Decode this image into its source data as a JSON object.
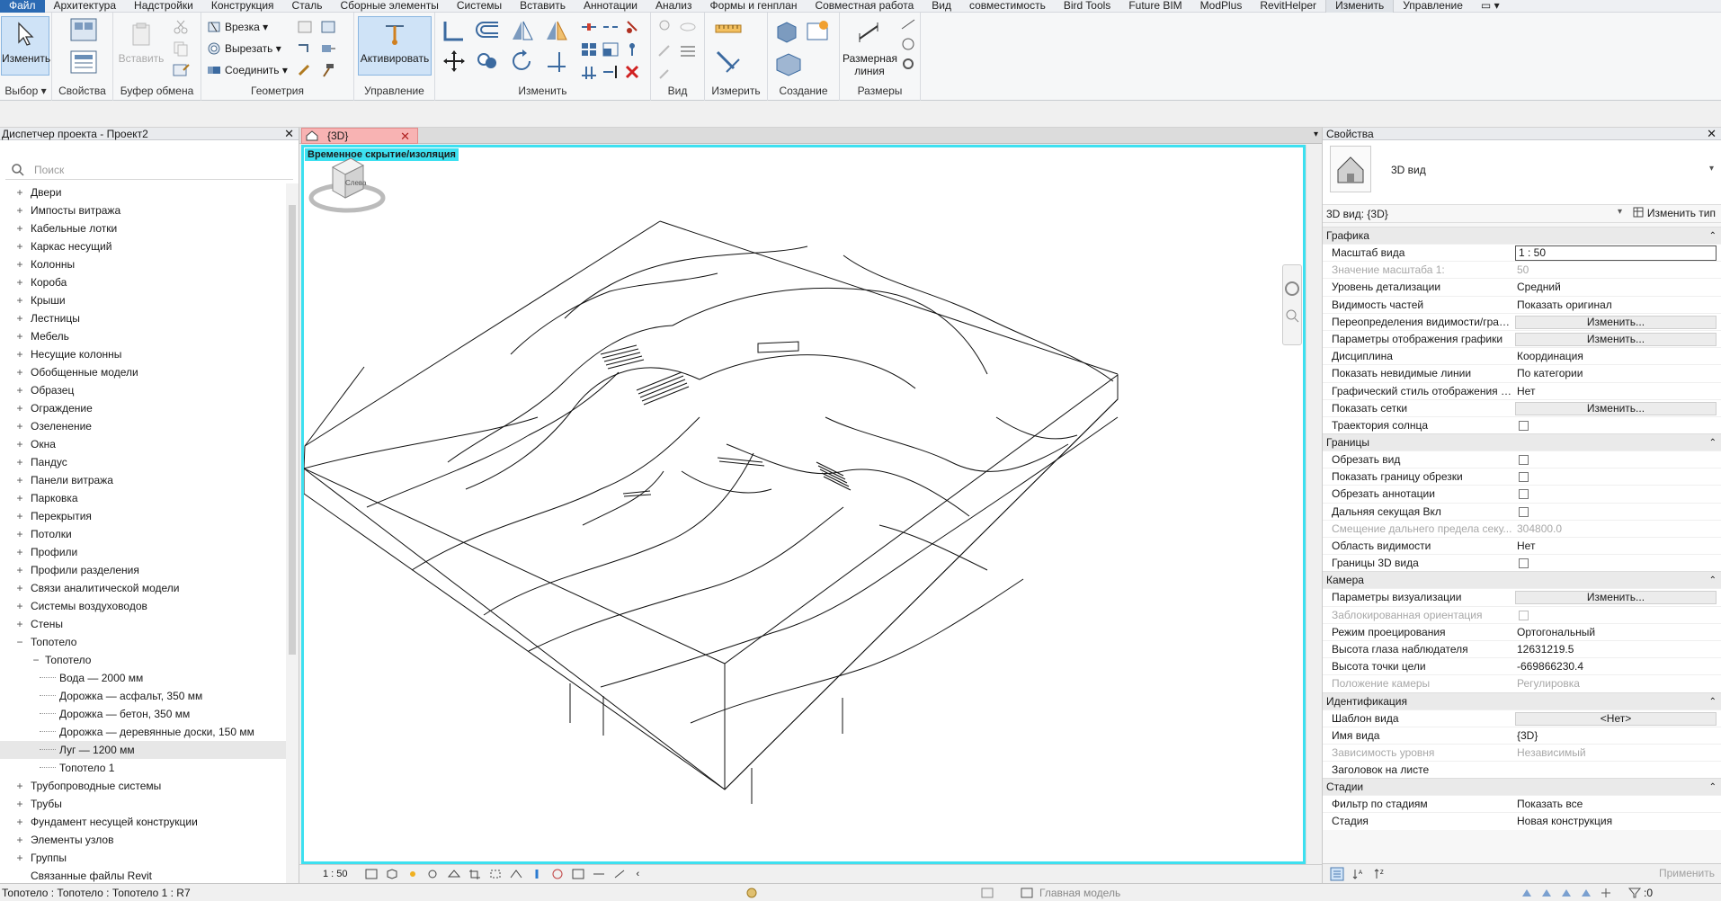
{
  "menu": {
    "tabs": [
      "Файл",
      "Архитектура",
      "Надстройки",
      "Конструкция",
      "Сталь",
      "Сборные элементы",
      "Системы",
      "Вставить",
      "Аннотации",
      "Анализ",
      "Формы и генплан",
      "Совместная работа",
      "Вид",
      "совместимость",
      "Bird Tools",
      "Future BIM",
      "ModPlus",
      "RevitHelper",
      "Изменить",
      "Управление"
    ]
  },
  "ribbon": {
    "select_label": "Изменить",
    "panels": {
      "select": "Выбор",
      "properties": "Свойства",
      "clipboard": "Буфер обмена",
      "geometry": "Геометрия",
      "control": "Управление",
      "modify": "Изменить",
      "view": "Вид",
      "measure": "Измерить",
      "create": "Создание",
      "dimensions": "Размеры"
    },
    "paste_label": "Вставить",
    "geometry_cut": "Врезка",
    "geometry_cutout": "Вырезать",
    "geometry_join": "Соединить",
    "activate_label": "Активировать",
    "dimension_label_1": "Размерная",
    "dimension_label_2": "линия"
  },
  "browser": {
    "title": "Диспетчер проекта - Проект2",
    "search_placeholder": "Поиск",
    "items": [
      {
        "label": "Двери",
        "toggle": "+",
        "level": 0
      },
      {
        "label": "Импосты витража",
        "toggle": "+",
        "level": 0
      },
      {
        "label": "Кабельные лотки",
        "toggle": "+",
        "level": 0
      },
      {
        "label": "Каркас несущий",
        "toggle": "+",
        "level": 0
      },
      {
        "label": "Колонны",
        "toggle": "+",
        "level": 0
      },
      {
        "label": "Короба",
        "toggle": "+",
        "level": 0
      },
      {
        "label": "Крыши",
        "toggle": "+",
        "level": 0
      },
      {
        "label": "Лестницы",
        "toggle": "+",
        "level": 0
      },
      {
        "label": "Мебель",
        "toggle": "+",
        "level": 0
      },
      {
        "label": "Несущие колонны",
        "toggle": "+",
        "level": 0
      },
      {
        "label": "Обобщенные модели",
        "toggle": "+",
        "level": 0
      },
      {
        "label": "Образец",
        "toggle": "+",
        "level": 0
      },
      {
        "label": "Ограждение",
        "toggle": "+",
        "level": 0
      },
      {
        "label": "Озеленение",
        "toggle": "+",
        "level": 0
      },
      {
        "label": "Окна",
        "toggle": "+",
        "level": 0
      },
      {
        "label": "Пандус",
        "toggle": "+",
        "level": 0
      },
      {
        "label": "Панели витража",
        "toggle": "+",
        "level": 0
      },
      {
        "label": "Парковка",
        "toggle": "+",
        "level": 0
      },
      {
        "label": "Перекрытия",
        "toggle": "+",
        "level": 0
      },
      {
        "label": "Потолки",
        "toggle": "+",
        "level": 0
      },
      {
        "label": "Профили",
        "toggle": "+",
        "level": 0
      },
      {
        "label": "Профили разделения",
        "toggle": "+",
        "level": 0
      },
      {
        "label": "Связи аналитической модели",
        "toggle": "+",
        "level": 0
      },
      {
        "label": "Системы воздуховодов",
        "toggle": "+",
        "level": 0
      },
      {
        "label": "Стены",
        "toggle": "+",
        "level": 0
      },
      {
        "label": "Топотело",
        "toggle": "−",
        "level": 0
      },
      {
        "label": "Топотело",
        "toggle": "−",
        "level": 1
      },
      {
        "label": "Вода — 2000 мм",
        "toggle": "",
        "level": 2
      },
      {
        "label": "Дорожка — асфальт, 350 мм",
        "toggle": "",
        "level": 2
      },
      {
        "label": "Дорожка — бетон, 350 мм",
        "toggle": "",
        "level": 2
      },
      {
        "label": "Дорожка — деревянные доски, 150 мм",
        "toggle": "",
        "level": 2
      },
      {
        "label": "Луг — 1200 мм",
        "toggle": "",
        "level": 2,
        "selected": true
      },
      {
        "label": "Топотело 1",
        "toggle": "",
        "level": 2
      },
      {
        "label": "Трубопроводные системы",
        "toggle": "+",
        "level": 0
      },
      {
        "label": "Трубы",
        "toggle": "+",
        "level": 0
      },
      {
        "label": "Фундамент несущей конструкции",
        "toggle": "+",
        "level": 0
      },
      {
        "label": "Элементы узлов",
        "toggle": "+",
        "level": 0
      },
      {
        "label": "Группы",
        "toggle": "+",
        "level": 0
      },
      {
        "label": "Связанные файлы Revit",
        "toggle": "",
        "level": 0
      }
    ]
  },
  "view": {
    "tab_label": "{3D}",
    "isolation_banner": "Временное скрытие/изоляция",
    "viewcube_face": "Слева",
    "scale": "1 : 50"
  },
  "properties": {
    "title": "Свойства",
    "type_name": "3D вид",
    "instance_label": "3D вид: {3D}",
    "edit_type": "Изменить тип",
    "apply": "Применить",
    "groups": [
      {
        "name": "Графика",
        "rows": [
          {
            "label": "Масштаб вида",
            "value": "1 : 50",
            "kind": "input"
          },
          {
            "label": "Значение масштаба    1:",
            "value": "50",
            "kind": "text",
            "disabled": true
          },
          {
            "label": "Уровень детализации",
            "value": "Средний",
            "kind": "text"
          },
          {
            "label": "Видимость частей",
            "value": "Показать оригинал",
            "kind": "text"
          },
          {
            "label": "Переопределения видимости/граф...",
            "value": "Изменить...",
            "kind": "button"
          },
          {
            "label": "Параметры отображения графики",
            "value": "Изменить...",
            "kind": "button"
          },
          {
            "label": "Дисциплина",
            "value": "Координация",
            "kind": "text"
          },
          {
            "label": "Показать невидимые линии",
            "value": "По категории",
            "kind": "text"
          },
          {
            "label": "Графический стиль отображения р...",
            "value": "Нет",
            "kind": "text"
          },
          {
            "label": "Показать сетки",
            "value": "Изменить...",
            "kind": "button"
          },
          {
            "label": "Траектория солнца",
            "value": "",
            "kind": "check"
          }
        ]
      },
      {
        "name": "Границы",
        "rows": [
          {
            "label": "Обрезать вид",
            "value": "",
            "kind": "check"
          },
          {
            "label": "Показать границу обрезки",
            "value": "",
            "kind": "check"
          },
          {
            "label": "Обрезать аннотации",
            "value": "",
            "kind": "check"
          },
          {
            "label": "Дальняя секущая Вкл",
            "value": "",
            "kind": "check"
          },
          {
            "label": "Смещение дальнего предела секу...",
            "value": "304800.0",
            "kind": "text",
            "disabled": true
          },
          {
            "label": "Область видимости",
            "value": "Нет",
            "kind": "text"
          },
          {
            "label": "Границы 3D вида",
            "value": "",
            "kind": "check"
          }
        ]
      },
      {
        "name": "Камера",
        "rows": [
          {
            "label": "Параметры визуализации",
            "value": "Изменить...",
            "kind": "button"
          },
          {
            "label": "Заблокированная ориентация",
            "value": "",
            "kind": "check",
            "disabled": true
          },
          {
            "label": "Режим проецирования",
            "value": "Ортогональный",
            "kind": "text"
          },
          {
            "label": "Высота глаза наблюдателя",
            "value": "12631219.5",
            "kind": "text"
          },
          {
            "label": "Высота точки цели",
            "value": "-669866230.4",
            "kind": "text"
          },
          {
            "label": "Положение камеры",
            "value": "Регулировка",
            "kind": "text",
            "disabled": true
          }
        ]
      },
      {
        "name": "Идентификация",
        "rows": [
          {
            "label": "Шаблон вида",
            "value": "<Нет>",
            "kind": "button"
          },
          {
            "label": "Имя вида",
            "value": "{3D}",
            "kind": "text"
          },
          {
            "label": "Зависимость уровня",
            "value": "Независимый",
            "kind": "text",
            "disabled": true
          },
          {
            "label": "Заголовок на листе",
            "value": "",
            "kind": "text"
          }
        ]
      },
      {
        "name": "Стадии",
        "rows": [
          {
            "label": "Фильтр по стадиям",
            "value": "Показать все",
            "kind": "text"
          },
          {
            "label": "Стадия",
            "value": "Новая конструкция",
            "kind": "text"
          }
        ]
      }
    ]
  },
  "status": {
    "text": "Топотело : Топотело : Топотело 1 : R7",
    "model": "Главная модель",
    "filter_count": ":0"
  },
  "colors": {
    "accent": "#2b6ab3",
    "isolation": "#3de0f0",
    "view_tab": "#f8b3b3"
  }
}
